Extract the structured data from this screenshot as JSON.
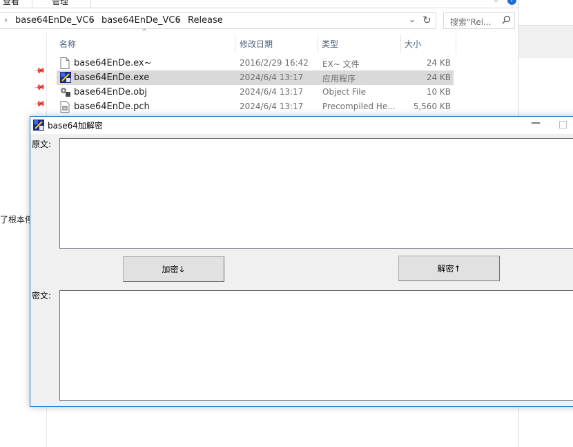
{
  "explorer": {
    "ribbon": {
      "tab1": "查看",
      "tab2": "管理"
    },
    "address": {
      "crumbs": [
        "base64EnDe_VC6",
        "base64EnDe_VC6",
        "Release"
      ]
    },
    "search": {
      "placeholder": "搜索\"Rel..."
    },
    "columns": {
      "name": "名称",
      "date": "修改日期",
      "type": "类型",
      "size": "大小"
    },
    "nav_stub": "了根本停不",
    "files": [
      {
        "name": "base64EnDe.ex~",
        "date": "2016/2/29 16:42",
        "type": "EX~ 文件",
        "size": "24 KB",
        "icon": "blank-file-icon"
      },
      {
        "name": "base64EnDe.exe",
        "date": "2024/6/4 13:17",
        "type": "应用程序",
        "size": "24 KB",
        "icon": "app-exe-icon"
      },
      {
        "name": "base64EnDe.obj",
        "date": "2024/6/4 13:17",
        "type": "Object File",
        "size": "10 KB",
        "icon": "object-file-icon"
      },
      {
        "name": "base64EnDe.pch",
        "date": "2024/6/4 13:17",
        "type": "Precompiled He...",
        "size": "5,560 KB",
        "icon": "pch-file-icon"
      }
    ]
  },
  "dialog": {
    "title": "base64加解密",
    "plain_label": "原文:",
    "cipher_label": "密文:",
    "plain_text": "",
    "cipher_text": "",
    "encrypt_button": "加密↓",
    "decrypt_button": "解密↑",
    "minimize_glyph": "—"
  },
  "colors": {
    "accent": "#1979ca",
    "selection": "#d9d9d9",
    "dialog_bg": "#f0f0f0"
  }
}
